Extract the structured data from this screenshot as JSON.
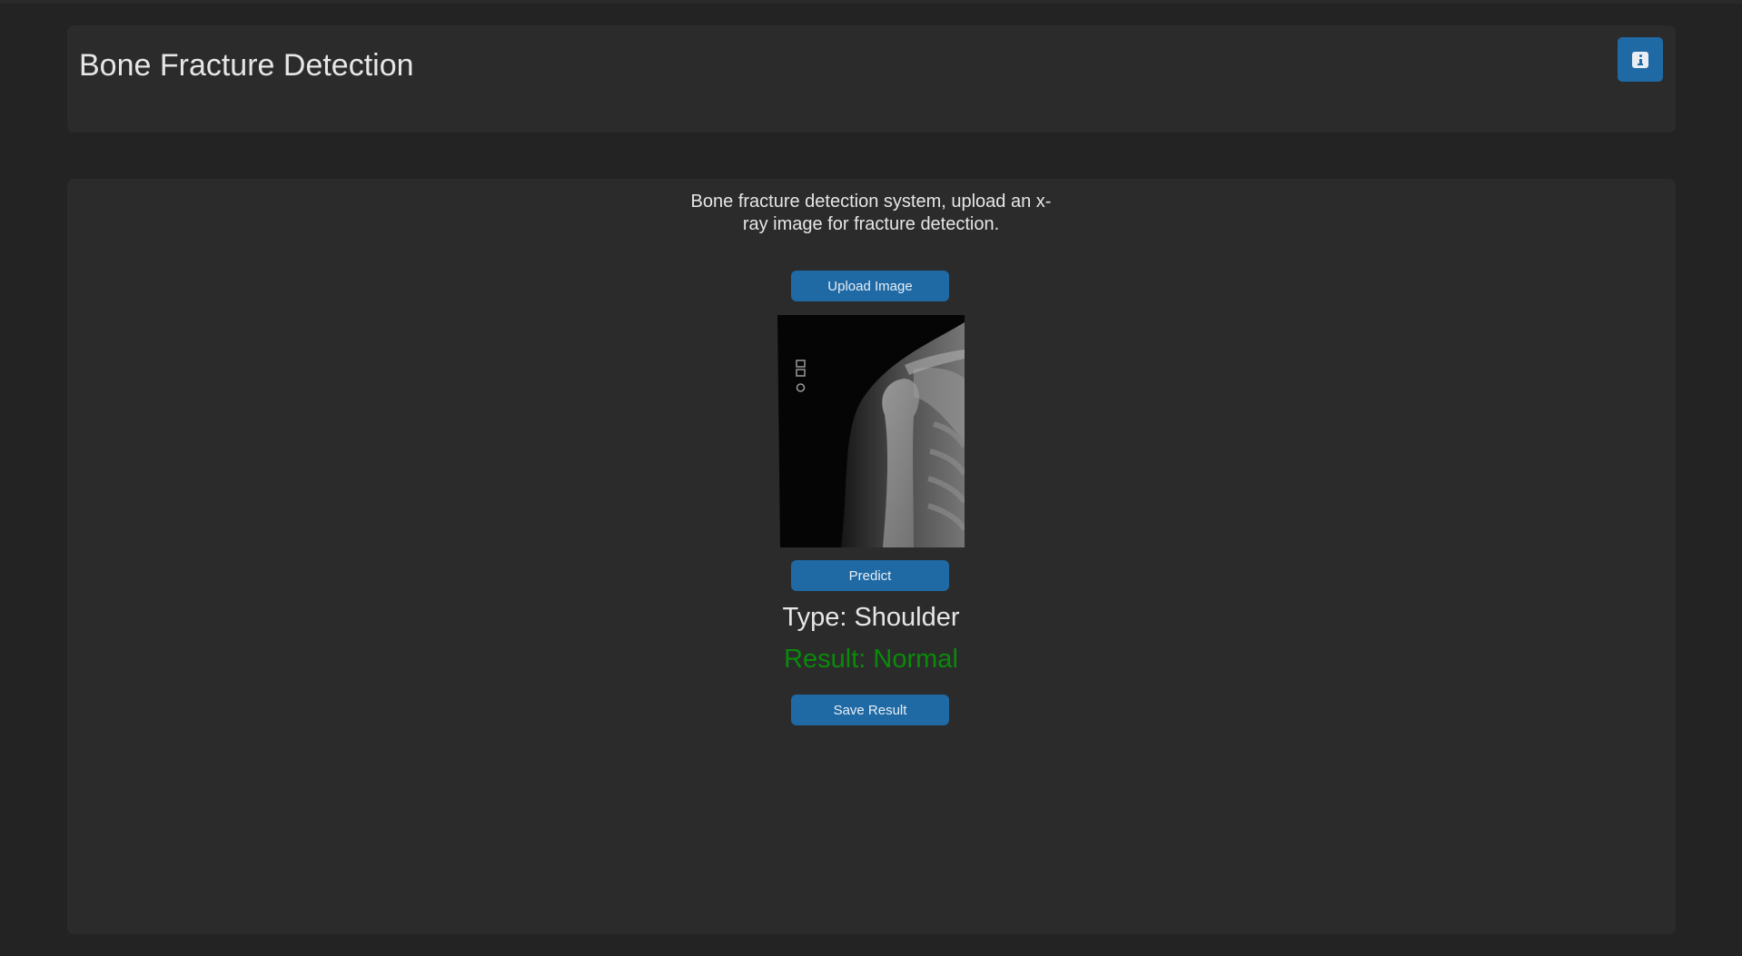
{
  "header": {
    "title": "Bone Fracture Detection",
    "info_icon": "info-icon"
  },
  "main": {
    "description": "Bone fracture detection system, upload an x-ray image for fracture detection.",
    "upload_label": "Upload Image",
    "preview_image": "shoulder-xray",
    "predict_label": "Predict",
    "type_text": "Type: Shoulder",
    "result_text": "Result: Normal",
    "save_label": "Save Result"
  },
  "colors": {
    "background": "#232323",
    "panel": "#2b2b2b",
    "accent": "#1f6aa5",
    "text": "#e6e6e6",
    "result_normal": "#0a8a0a"
  }
}
